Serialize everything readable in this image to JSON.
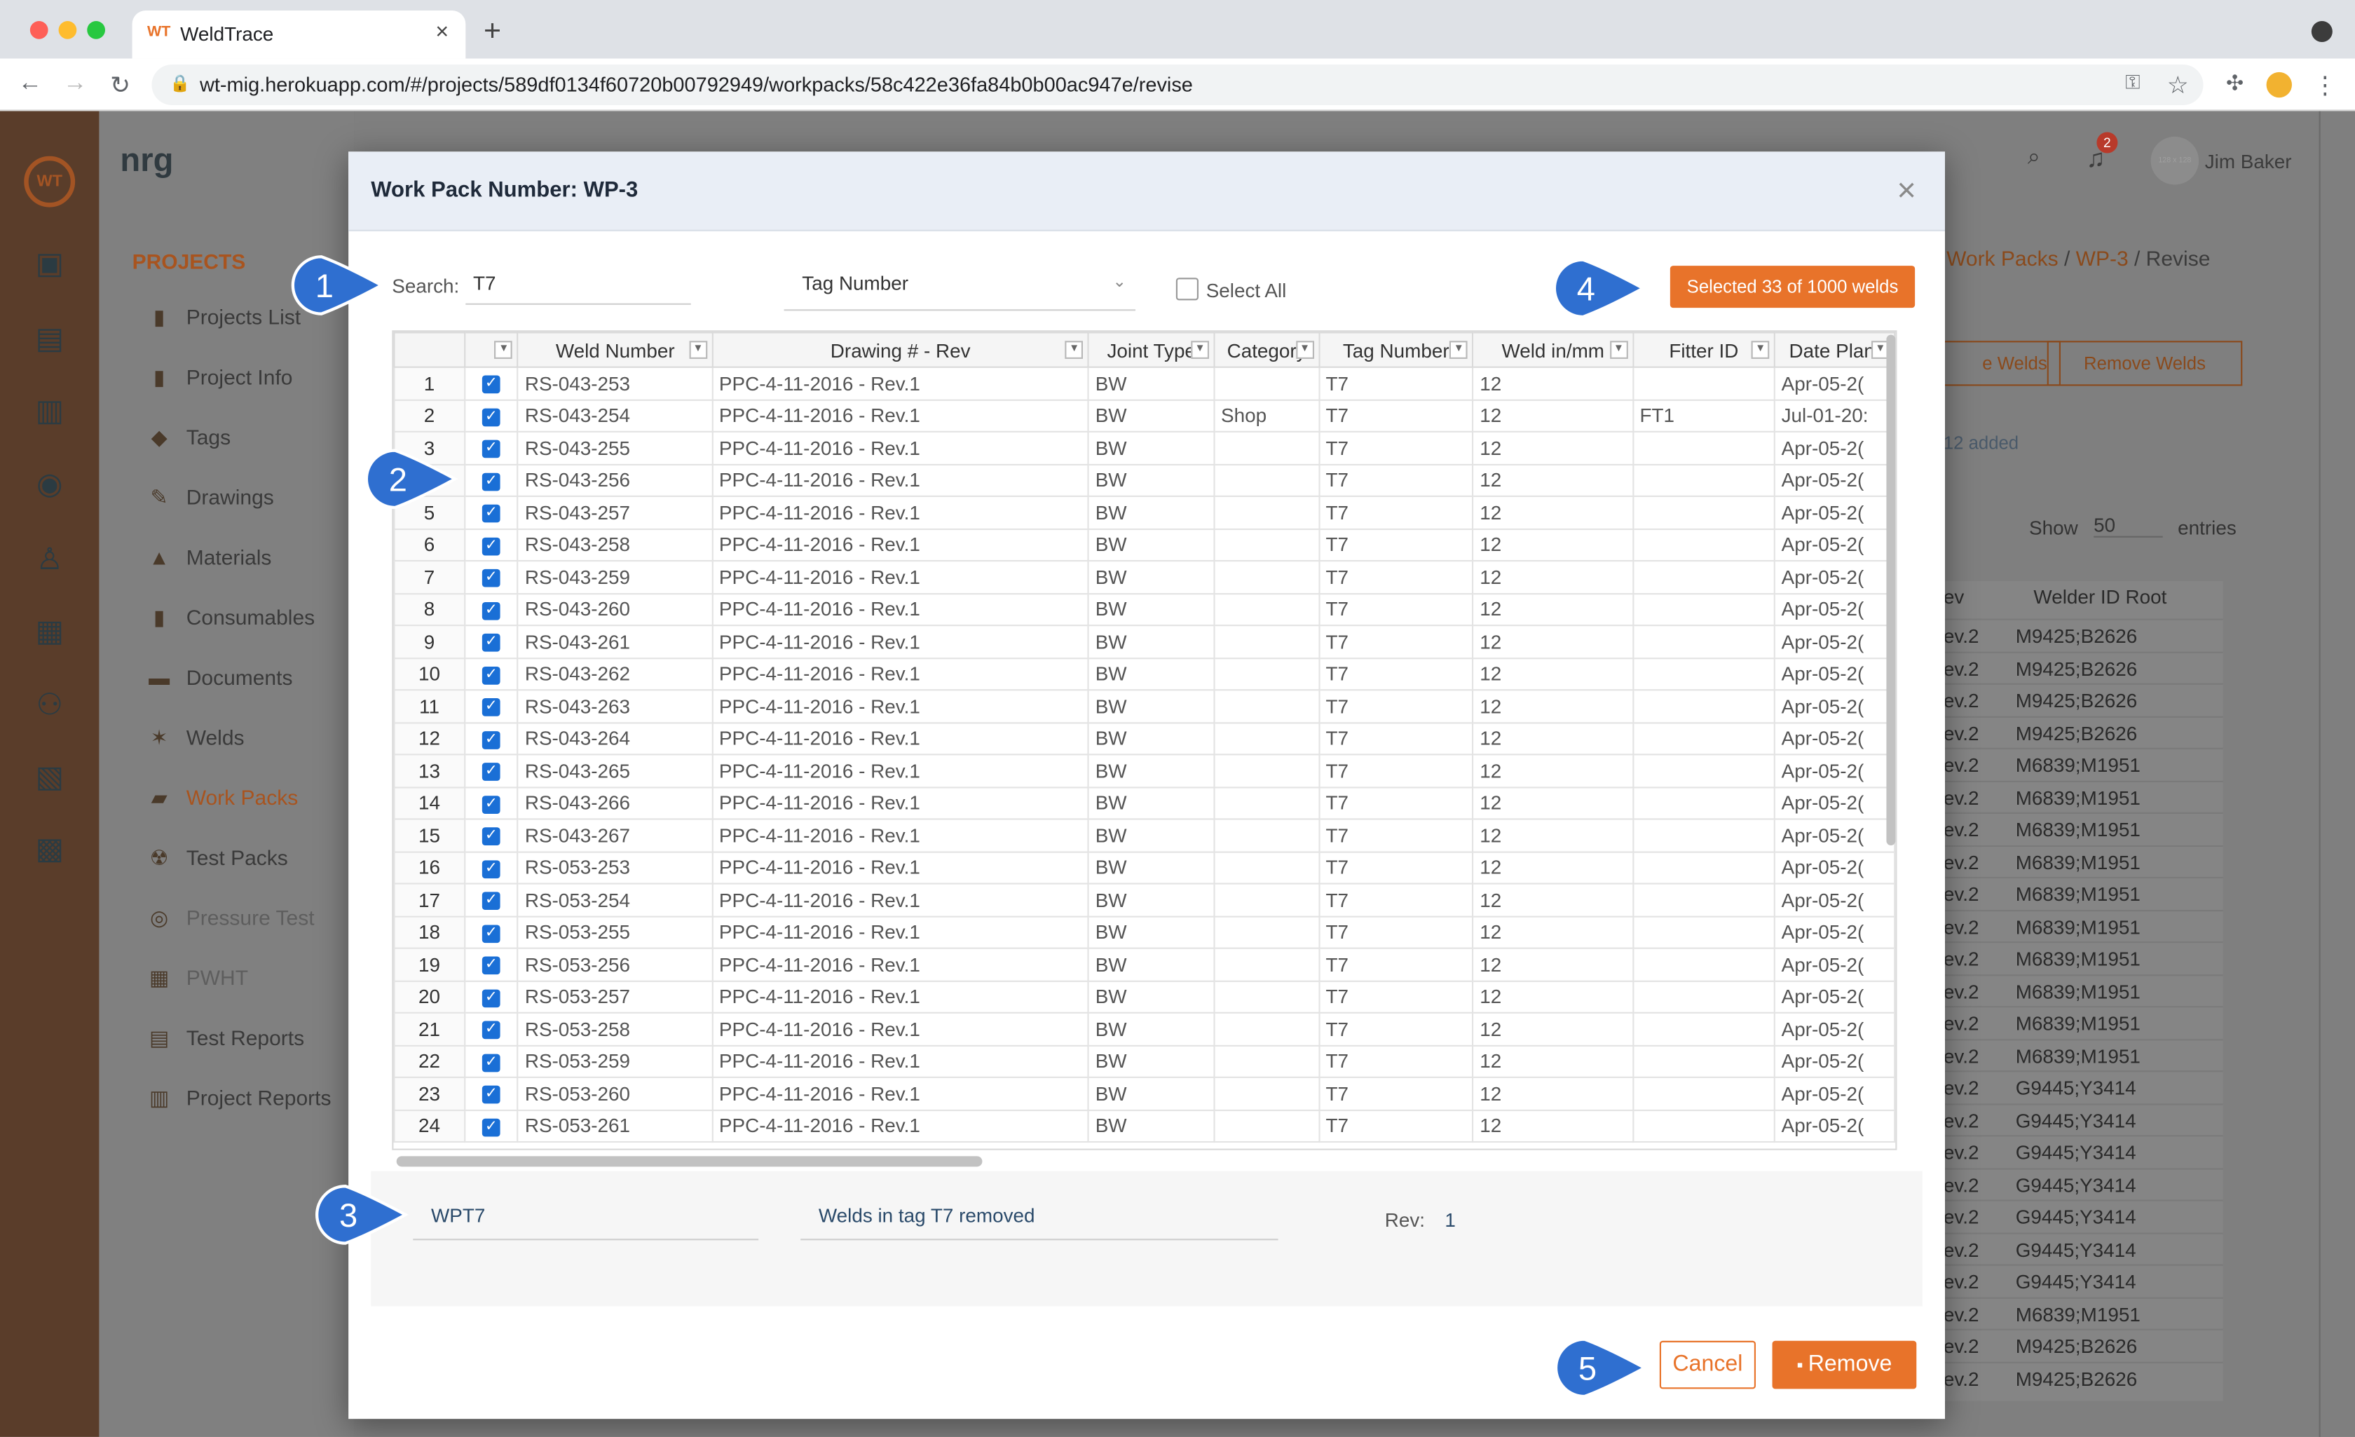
{
  "browser": {
    "tab_title": "WeldTrace",
    "tab_favicon": "WT",
    "url": "wt-mig.herokuapp.com/#/projects/589df0134f60720b00792949/workpacks/58c422e36fa84b0b00ac947e/revise"
  },
  "app": {
    "brand": "nrg",
    "sidebar_heading": "PROJECTS",
    "sidebar_items": [
      "Projects List",
      "Project Info",
      "Tags",
      "Drawings",
      "Materials",
      "Consumables",
      "Documents",
      "Welds",
      "Work Packs",
      "Test Packs",
      "Pressure Test",
      "PWHT",
      "Test Reports",
      "Project Reports"
    ],
    "active_item": "Work Packs",
    "user": "Jim Baker",
    "notifications": "2",
    "avatar_text": "128 x 128",
    "breadcrumb": [
      "Work Packs",
      "WP-3",
      "Revise"
    ],
    "bg_buttons": [
      "e Welds",
      "Remove Welds"
    ],
    "bg_added": "12 added",
    "show_label": "Show",
    "show_value": "50",
    "entries_label": "entries",
    "bg_columns": [
      "ev",
      "Welder ID Root"
    ],
    "bg_rows": [
      [
        "ev.2",
        "M9425;B2626"
      ],
      [
        "ev.2",
        "M9425;B2626"
      ],
      [
        "ev.2",
        "M9425;B2626"
      ],
      [
        "ev.2",
        "M9425;B2626"
      ],
      [
        "ev.2",
        "M6839;M1951"
      ],
      [
        "ev.2",
        "M6839;M1951"
      ],
      [
        "ev.2",
        "M6839;M1951"
      ],
      [
        "ev.2",
        "M6839;M1951"
      ],
      [
        "ev.2",
        "M6839;M1951"
      ],
      [
        "ev.2",
        "M6839;M1951"
      ],
      [
        "ev.2",
        "M6839;M1951"
      ],
      [
        "ev.2",
        "M6839;M1951"
      ],
      [
        "ev.2",
        "M6839;M1951"
      ],
      [
        "ev.2",
        "M6839;M1951"
      ],
      [
        "ev.2",
        "G9445;Y3414"
      ],
      [
        "ev.2",
        "G9445;Y3414"
      ],
      [
        "ev.2",
        "G9445;Y3414"
      ],
      [
        "ev.2",
        "G9445;Y3414"
      ],
      [
        "ev.2",
        "G9445;Y3414"
      ],
      [
        "ev.2",
        "G9445;Y3414"
      ],
      [
        "ev.2",
        "G9445;Y3414"
      ],
      [
        "ev.2",
        "M6839;M1951"
      ],
      [
        "ev.2",
        "M9425;B2626"
      ],
      [
        "ev.2",
        "M9425;B2626"
      ]
    ]
  },
  "modal": {
    "title": "Work Pack Number: WP-3",
    "close": "×",
    "search_label": "Search:",
    "search_value": "T7",
    "filter_field": "Tag Number",
    "select_all": "Select All",
    "selected_badge": "Selected 33 of 1000 welds",
    "columns": [
      "",
      "",
      "Weld Number",
      "Drawing # - Rev",
      "Joint Type",
      "Category",
      "Tag Number",
      "Weld in/mm",
      "Fitter ID",
      "Date Planı"
    ],
    "rows": [
      [
        "1",
        "RS-043-253",
        "PPC-4-11-2016 - Rev.1",
        "BW",
        "",
        "T7",
        "12",
        "",
        "Apr-05-2("
      ],
      [
        "2",
        "RS-043-254",
        "PPC-4-11-2016 - Rev.1",
        "BW",
        "Shop",
        "T7",
        "12",
        "FT1",
        "Jul-01-20:"
      ],
      [
        "3",
        "RS-043-255",
        "PPC-4-11-2016 - Rev.1",
        "BW",
        "",
        "T7",
        "12",
        "",
        "Apr-05-2("
      ],
      [
        "4",
        "RS-043-256",
        "PPC-4-11-2016 - Rev.1",
        "BW",
        "",
        "T7",
        "12",
        "",
        "Apr-05-2("
      ],
      [
        "5",
        "RS-043-257",
        "PPC-4-11-2016 - Rev.1",
        "BW",
        "",
        "T7",
        "12",
        "",
        "Apr-05-2("
      ],
      [
        "6",
        "RS-043-258",
        "PPC-4-11-2016 - Rev.1",
        "BW",
        "",
        "T7",
        "12",
        "",
        "Apr-05-2("
      ],
      [
        "7",
        "RS-043-259",
        "PPC-4-11-2016 - Rev.1",
        "BW",
        "",
        "T7",
        "12",
        "",
        "Apr-05-2("
      ],
      [
        "8",
        "RS-043-260",
        "PPC-4-11-2016 - Rev.1",
        "BW",
        "",
        "T7",
        "12",
        "",
        "Apr-05-2("
      ],
      [
        "9",
        "RS-043-261",
        "PPC-4-11-2016 - Rev.1",
        "BW",
        "",
        "T7",
        "12",
        "",
        "Apr-05-2("
      ],
      [
        "10",
        "RS-043-262",
        "PPC-4-11-2016 - Rev.1",
        "BW",
        "",
        "T7",
        "12",
        "",
        "Apr-05-2("
      ],
      [
        "11",
        "RS-043-263",
        "PPC-4-11-2016 - Rev.1",
        "BW",
        "",
        "T7",
        "12",
        "",
        "Apr-05-2("
      ],
      [
        "12",
        "RS-043-264",
        "PPC-4-11-2016 - Rev.1",
        "BW",
        "",
        "T7",
        "12",
        "",
        "Apr-05-2("
      ],
      [
        "13",
        "RS-043-265",
        "PPC-4-11-2016 - Rev.1",
        "BW",
        "",
        "T7",
        "12",
        "",
        "Apr-05-2("
      ],
      [
        "14",
        "RS-043-266",
        "PPC-4-11-2016 - Rev.1",
        "BW",
        "",
        "T7",
        "12",
        "",
        "Apr-05-2("
      ],
      [
        "15",
        "RS-043-267",
        "PPC-4-11-2016 - Rev.1",
        "BW",
        "",
        "T7",
        "12",
        "",
        "Apr-05-2("
      ],
      [
        "16",
        "RS-053-253",
        "PPC-4-11-2016 - Rev.1",
        "BW",
        "",
        "T7",
        "12",
        "",
        "Apr-05-2("
      ],
      [
        "17",
        "RS-053-254",
        "PPC-4-11-2016 - Rev.1",
        "BW",
        "",
        "T7",
        "12",
        "",
        "Apr-05-2("
      ],
      [
        "18",
        "RS-053-255",
        "PPC-4-11-2016 - Rev.1",
        "BW",
        "",
        "T7",
        "12",
        "",
        "Apr-05-2("
      ],
      [
        "19",
        "RS-053-256",
        "PPC-4-11-2016 - Rev.1",
        "BW",
        "",
        "T7",
        "12",
        "",
        "Apr-05-2("
      ],
      [
        "20",
        "RS-053-257",
        "PPC-4-11-2016 - Rev.1",
        "BW",
        "",
        "T7",
        "12",
        "",
        "Apr-05-2("
      ],
      [
        "21",
        "RS-053-258",
        "PPC-4-11-2016 - Rev.1",
        "BW",
        "",
        "T7",
        "12",
        "",
        "Apr-05-2("
      ],
      [
        "22",
        "RS-053-259",
        "PPC-4-11-2016 - Rev.1",
        "BW",
        "",
        "T7",
        "12",
        "",
        "Apr-05-2("
      ],
      [
        "23",
        "RS-053-260",
        "PPC-4-11-2016 - Rev.1",
        "BW",
        "",
        "T7",
        "12",
        "",
        "Apr-05-2("
      ],
      [
        "24",
        "RS-053-261",
        "PPC-4-11-2016 - Rev.1",
        "BW",
        "",
        "T7",
        "12",
        "",
        "Apr-05-2("
      ]
    ],
    "footer": {
      "name_value": "WPT7",
      "comment_value": "Welds in tag T7 removed",
      "rev_label": "Rev:",
      "rev_value": "1"
    },
    "cancel": "Cancel",
    "remove": "Remove"
  },
  "callouts": [
    "1",
    "2",
    "3",
    "4",
    "5"
  ],
  "colors": {
    "accent": "#e8732a",
    "checkbox": "#1a6fd6",
    "callout": "#2f6fd0"
  }
}
